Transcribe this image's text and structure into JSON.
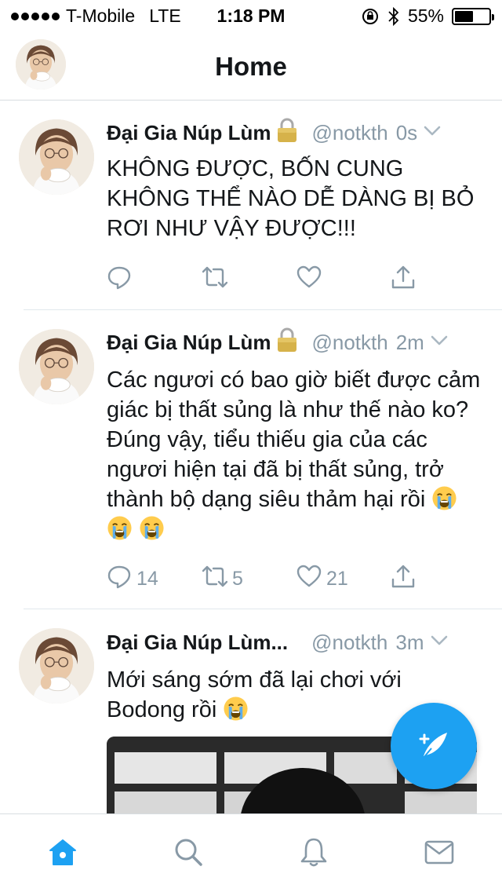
{
  "status_bar": {
    "carrier": "T-Mobile",
    "network": "LTE",
    "time": "1:18 PM",
    "battery": "55%",
    "battery_level": 0.55
  },
  "header": {
    "title": "Home"
  },
  "tweets": [
    {
      "name": "Đại Gia Núp Lùm",
      "handle": "@notkth",
      "time": "0s",
      "text": "KHÔNG ĐƯỢC, BỐN CUNG KHÔNG THỂ NÀO DỄ DÀNG BỊ BỎ RƠI NHƯ VẬY ĐƯỢC!!!",
      "replies": "",
      "retweets": "",
      "likes": ""
    },
    {
      "name": "Đại Gia Núp Lùm",
      "handle": "@notkth",
      "time": "2m",
      "text": "Các ngươi có bao giờ biết được cảm giác bị thất sủng là như thế nào ko? Đúng vậy, tiểu thiếu gia của các ngươi hiện tại đã bị thất sủng, trở thành bộ dạng siêu thảm hại rồi",
      "replies": "14",
      "retweets": "5",
      "likes": "21"
    },
    {
      "name": "Đại Gia Núp Lùm...",
      "handle": "@notkth",
      "time": "3m",
      "text": "Mới sáng sớm đã lại chơi với Bodong rồi"
    }
  ],
  "colors": {
    "accent": "#1da1f2",
    "muted": "#8899a6",
    "text": "#14171a"
  },
  "icons": {
    "reply": "reply-icon",
    "retweet": "retweet-icon",
    "like": "heart-icon",
    "share": "share-icon",
    "lock": "lock-icon",
    "compose": "compose-icon",
    "home": "home-icon",
    "search": "search-icon",
    "notifications": "bell-icon",
    "messages": "envelope-icon"
  }
}
